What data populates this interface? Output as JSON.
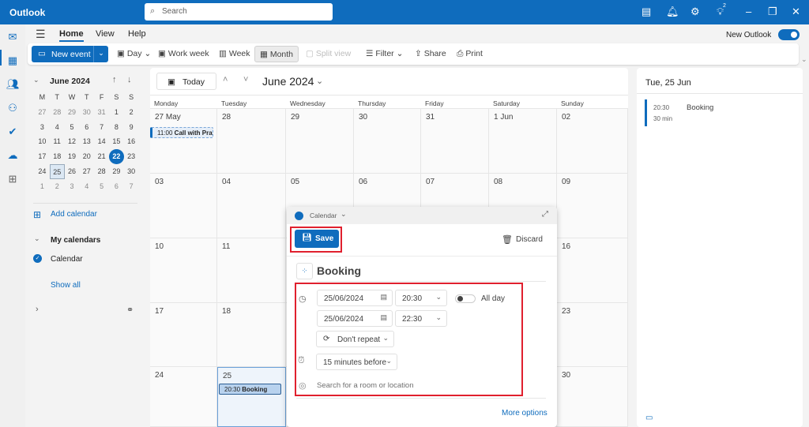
{
  "app": {
    "title": "Outlook",
    "search_placeholder": "Search",
    "notification_count": "2",
    "new_outlook_label": "New Outlook",
    "new_outlook_on": true
  },
  "menu": {
    "tabs": [
      "Home",
      "View",
      "Help"
    ]
  },
  "ribbon": {
    "new_event": "New event",
    "day": "Day",
    "work_week": "Work week",
    "week": "Week",
    "month": "Month",
    "split_view": "Split view",
    "filter": "Filter",
    "share": "Share",
    "print": "Print"
  },
  "mini_calendar": {
    "title": "June 2024",
    "weekdays": [
      "M",
      "T",
      "W",
      "T",
      "F",
      "S",
      "S"
    ],
    "days": [
      [
        "27",
        "28",
        "29",
        "30",
        "31",
        "1",
        "2"
      ],
      [
        "3",
        "4",
        "5",
        "6",
        "7",
        "8",
        "9"
      ],
      [
        "10",
        "11",
        "12",
        "13",
        "14",
        "15",
        "16"
      ],
      [
        "17",
        "18",
        "19",
        "20",
        "21",
        "22",
        "23"
      ],
      [
        "24",
        "25",
        "26",
        "27",
        "28",
        "29",
        "30"
      ],
      [
        "1",
        "2",
        "3",
        "4",
        "5",
        "6",
        "7"
      ]
    ],
    "today": "22",
    "selected": "25"
  },
  "sidebar": {
    "add_calendar": "Add calendar",
    "my_calendars": "My calendars",
    "calendar": "Calendar",
    "show_all": "Show all"
  },
  "calendar": {
    "today_label": "Today",
    "title": "June 2024",
    "weekdays": [
      "Monday",
      "Tuesday",
      "Wednesday",
      "Thursday",
      "Friday",
      "Saturday",
      "Sunday"
    ],
    "weeks": [
      [
        "27 May",
        "28",
        "29",
        "30",
        "31",
        "1 Jun",
        "02"
      ],
      [
        "03",
        "04",
        "05",
        "06",
        "07",
        "08",
        "09"
      ],
      [
        "10",
        "11",
        "",
        "",
        "",
        "",
        "16"
      ],
      [
        "17",
        "18",
        "",
        "",
        "",
        "",
        "23"
      ],
      [
        "24",
        "25",
        "",
        "",
        "",
        "",
        "30"
      ]
    ],
    "events": [
      {
        "time": "11:00",
        "title": "Call with Prac"
      },
      {
        "time": "20:30",
        "title": "Booking"
      }
    ]
  },
  "agenda": {
    "date": "Tue, 25 Jun",
    "events": [
      {
        "time": "20:30",
        "duration": "30 min",
        "title": "Booking"
      }
    ]
  },
  "dialog": {
    "calendar": "Calendar",
    "save": "Save",
    "discard": "Discard",
    "title": "Booking",
    "start_date": "25/06/2024",
    "start_time": "20:30",
    "all_day": "All day",
    "end_date": "25/06/2024",
    "end_time": "22:30",
    "repeat": "Don't repeat",
    "reminder": "15 minutes before",
    "location_placeholder": "Search for a room or location",
    "more_options": "More options"
  },
  "colors": {
    "brand": "#0f6cbd",
    "highlight": "#e0202e"
  }
}
